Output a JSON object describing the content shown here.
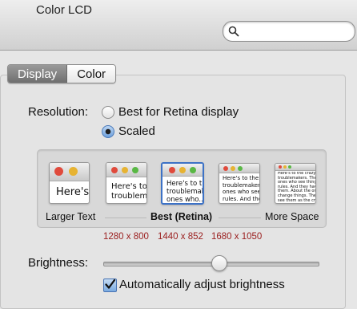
{
  "window": {
    "title": "Color LCD"
  },
  "search": {
    "placeholder": "",
    "value": ""
  },
  "tabs": [
    {
      "label": "Display",
      "selected": true
    },
    {
      "label": "Color",
      "selected": false
    }
  ],
  "resolution": {
    "label": "Resolution:",
    "options": [
      {
        "label": "Best for Retina display",
        "selected": false
      },
      {
        "label": "Scaled",
        "selected": true
      }
    ]
  },
  "scaled_options": [
    {
      "label": "Larger Text",
      "resolution": "",
      "preview_text": "Here's"
    },
    {
      "label": "",
      "resolution": "1280 x 800",
      "preview_text": "Here's to the\ntroublemakers"
    },
    {
      "label": "Best (Retina)",
      "resolution": "1440 x 852",
      "preview_text": "Here's to the\ntroublemak...\nones who..."
    },
    {
      "label": "",
      "resolution": "1680 x 1050",
      "preview_text": "Here's to the cr\ntroublemakers.\nones who see th\nrules. And they"
    },
    {
      "label": "More Space",
      "resolution": "",
      "preview_text": "Here's to the crazy one\ntroublemakers. The rou\nones who see things di\nrules. And they have n\nthem. About the only th\nchange things. They pu\nsee them as the crazy o"
    }
  ],
  "selected_scale_index": 2,
  "brightness": {
    "label": "Brightness:",
    "level": 0.54
  },
  "auto_brightness": {
    "label": "Automatically adjust brightness",
    "checked": true
  }
}
